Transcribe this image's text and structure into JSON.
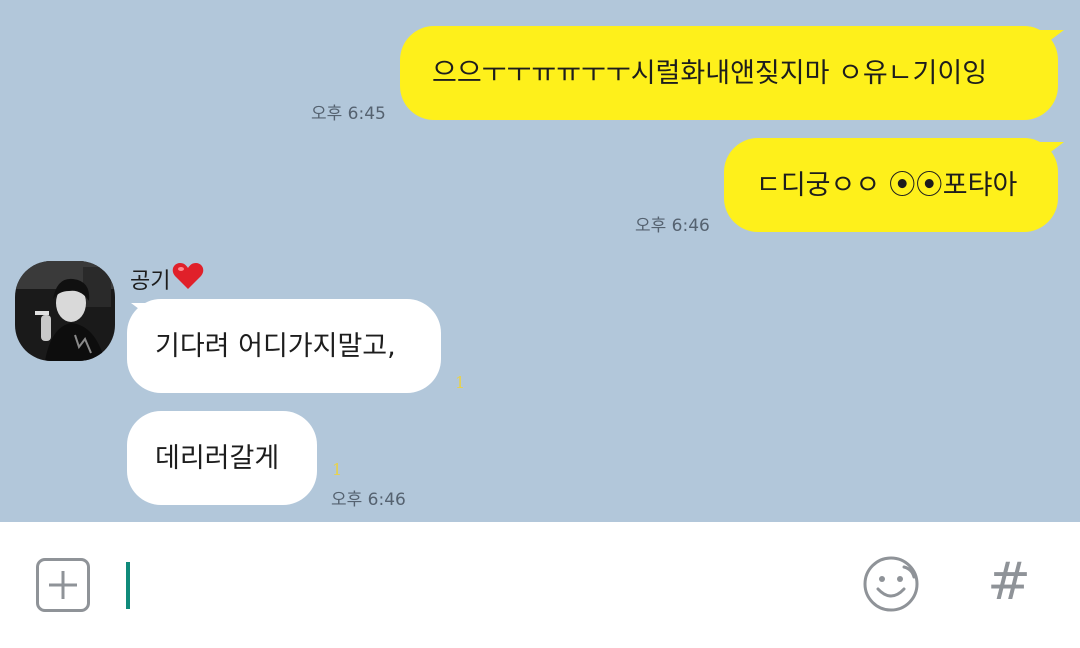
{
  "messages": [
    {
      "direction": "out",
      "text": "으으ㅜㅜㅠㅠㅜㅜ시럴화내앤짖지마 ㅇ유ㄴ기이잉",
      "time": "오후 6:45"
    },
    {
      "direction": "out",
      "text": "ㄷ디궁ㅇㅇ ⦿⦿포탸아",
      "time": "오후 6:46"
    },
    {
      "direction": "in",
      "text": "기다려 어디가지말고,",
      "unread": "1"
    },
    {
      "direction": "in",
      "text": "데리러갈게",
      "unread": "1",
      "time": "오후 6:46"
    }
  ],
  "sender": {
    "name": "공기",
    "heart": "❤️"
  },
  "input_bar": {
    "plus_icon": "plus-box-icon",
    "emoji_icon": "smiley-icon",
    "hash_label": "#"
  },
  "colors": {
    "chat_bg": "#b2c7da",
    "outgoing_bubble": "#fef01b",
    "incoming_bubble": "#ffffff",
    "cursor": "#0f8a7a"
  }
}
